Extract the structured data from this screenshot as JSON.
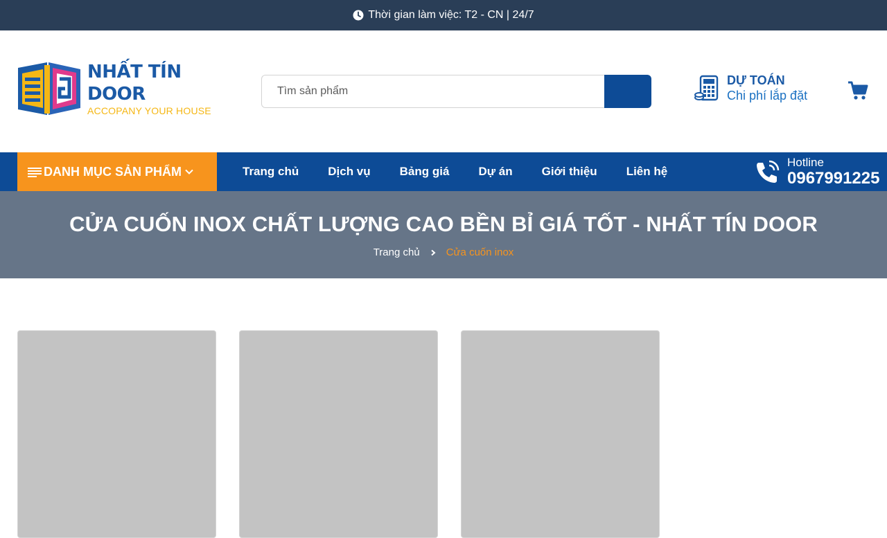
{
  "topbar": {
    "hours": "Thời gian làm việc: T2 - CN | 24/7",
    "icon": "clock-icon"
  },
  "logo": {
    "name": "NHẤT TÍN DOOR",
    "slogan": "ACCOPANY YOUR HOUSE",
    "colors": {
      "blue": "#1b5aa6",
      "yellow": "#f5b715"
    }
  },
  "search": {
    "placeholder": "Tìm sản phẩm",
    "value": "",
    "icon": "search-icon"
  },
  "estimate": {
    "title": "DỰ TOÁN",
    "subtitle": "Chi phí lắp đặt",
    "icon": "calculator-icon"
  },
  "cart": {
    "icon": "cart-icon"
  },
  "nav": {
    "category_label": "DANH MỤC SẢN PHẨM",
    "links": [
      "Trang chủ",
      "Dịch vụ",
      "Bảng giá",
      "Dự án",
      "Giới thiệu",
      "Liên hệ"
    ],
    "hotline_label": "Hotline",
    "hotline_number": "0967991225",
    "colors": {
      "nav_bg": "#0d4b96",
      "category_bg": "#f7941d"
    }
  },
  "banner": {
    "title": "CỬA CUỐN INOX CHẤT LƯỢNG CAO BỀN BỈ GIÁ TỐT - NHẤT TÍN DOOR",
    "breadcrumb": {
      "home": "Trang chủ",
      "current": "Cửa cuốn inox"
    }
  },
  "products": {
    "placeholder_count": 3
  }
}
